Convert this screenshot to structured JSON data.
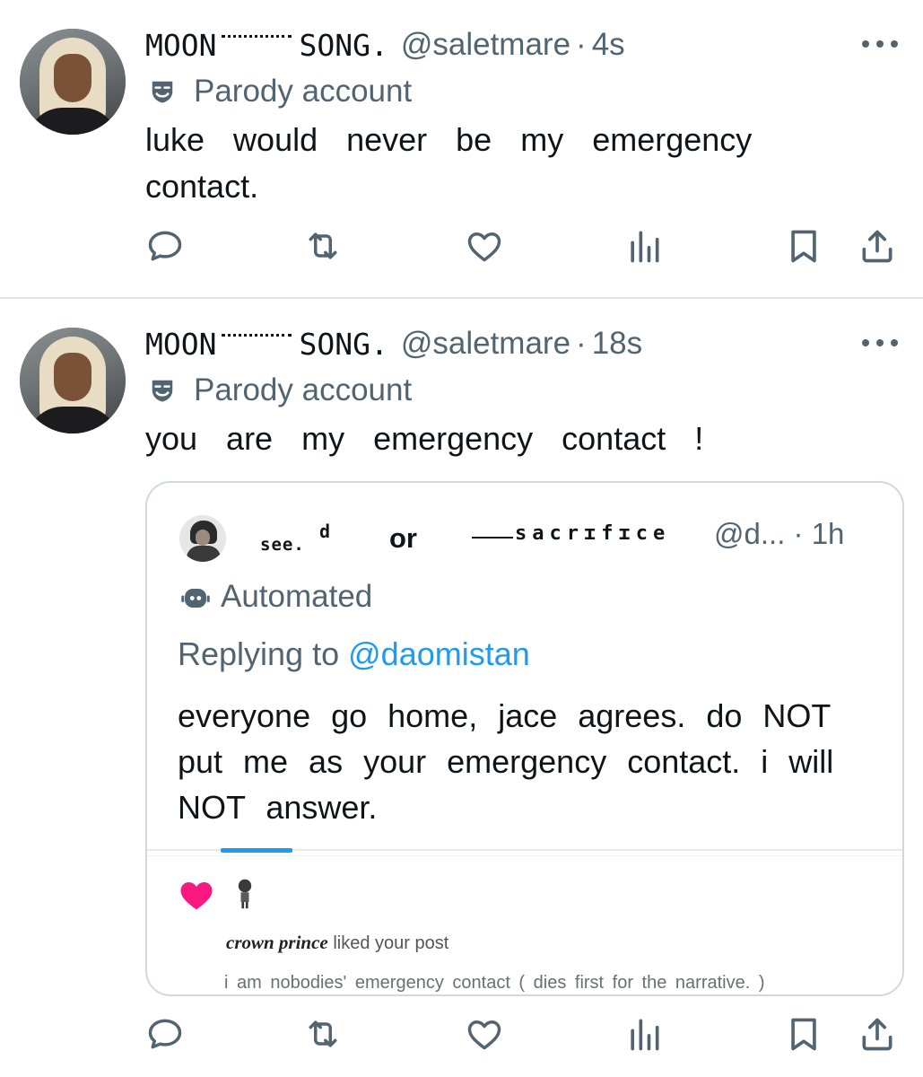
{
  "tweets": [
    {
      "display_name": "MOON",
      "display_name_2": "SONG.",
      "handle": "@saletmare",
      "separator": "·",
      "time": "4s",
      "label": "Parody account",
      "text": "luke would never be my emergency contact.",
      "label_icon": "parody-mask-icon"
    },
    {
      "display_name": "MOON",
      "display_name_2": "SONG.",
      "handle": "@saletmare",
      "separator": "·",
      "time": "18s",
      "label": "Parody account",
      "text": "you are my emergency contact !",
      "label_icon": "parody-mask-icon"
    }
  ],
  "quote": {
    "name_part1": "see.",
    "name_part1_sup": "d",
    "name_part2": "or",
    "name_part3": "sacrɪfɪce",
    "handle": "@d...",
    "separator": "·",
    "time": "1h",
    "label": "Automated",
    "label_icon": "bot-icon",
    "replying_prefix": "Replying to",
    "replying_mention": "@daomistan",
    "text": "everyone go home, jace agrees. do NOT put me as your emergency contact. i will NOT answer.",
    "like_user": "crown prince",
    "like_suffix": "liked your post",
    "liked_post_text": "i am nobodies' emergency contact  (   dies first for the narrative.  )"
  },
  "colors": {
    "text": "#0f1419",
    "secondary": "#536471",
    "accent": "#1d9bf0",
    "heart": "#f91880",
    "divider": "#dfe3e6"
  },
  "actions": [
    "reply-icon",
    "repost-icon",
    "like-icon",
    "views-icon",
    "bookmark-icon",
    "share-icon"
  ]
}
